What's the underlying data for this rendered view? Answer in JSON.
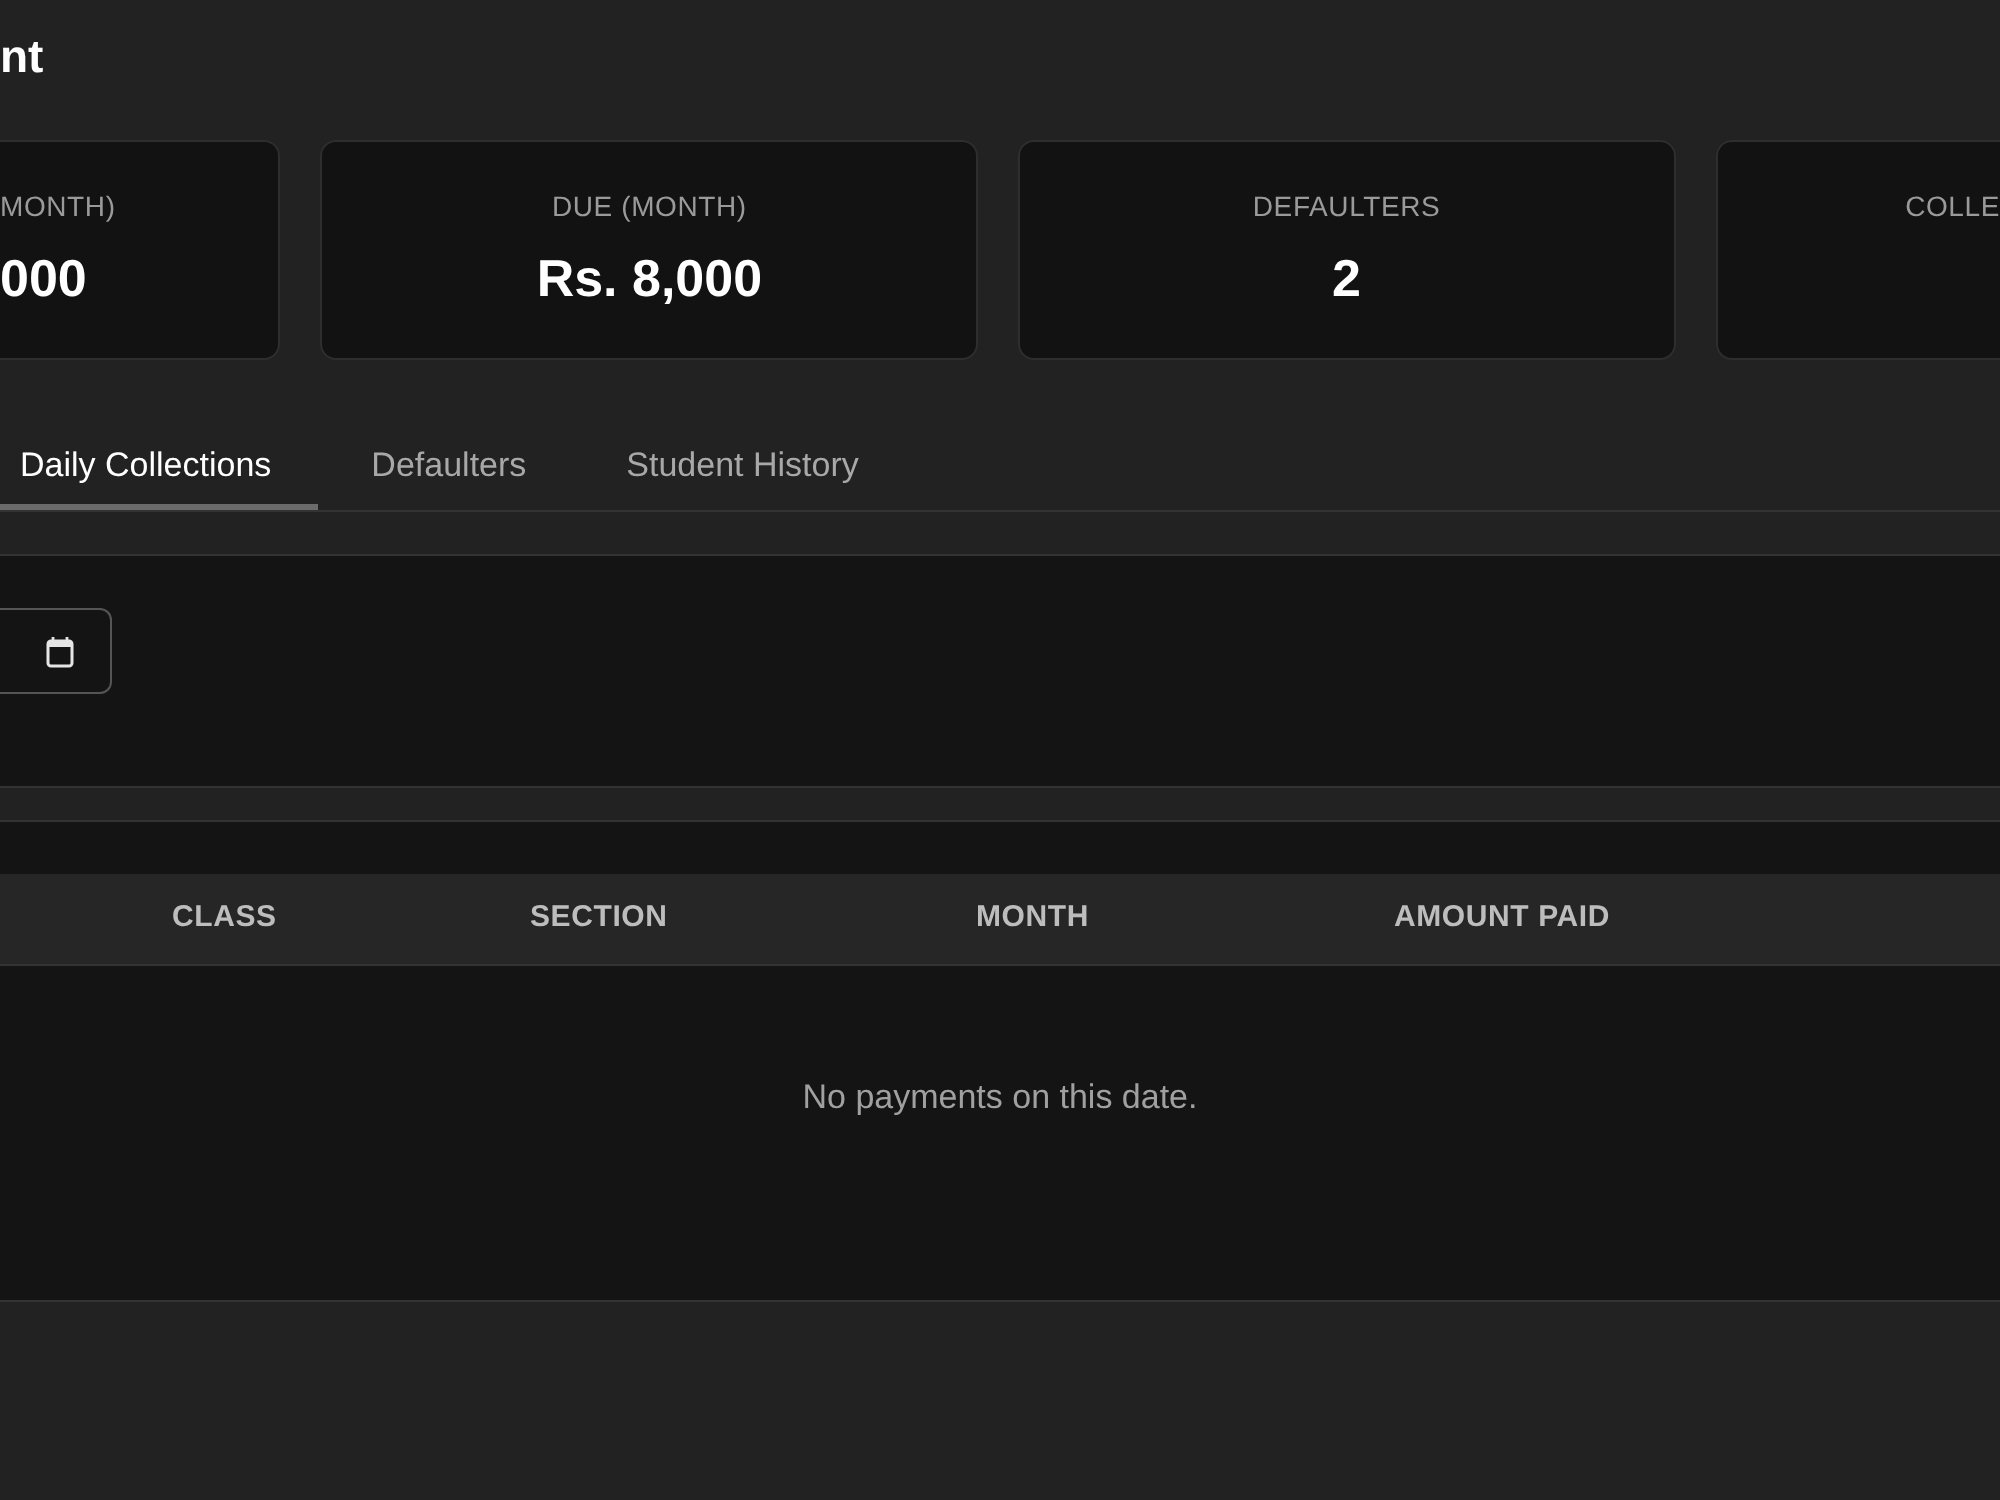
{
  "page": {
    "title": "nt"
  },
  "stats": [
    {
      "label": "MONTH)",
      "value": "000"
    },
    {
      "label": "DUE (MONTH)",
      "value": "Rs. 8,000"
    },
    {
      "label": "DEFAULTERS",
      "value": "2"
    },
    {
      "label": "COLLE"
    }
  ],
  "tabs": [
    {
      "label": "Daily Collections",
      "selected": true
    },
    {
      "label": "Defaulters",
      "selected": false
    },
    {
      "label": "Student History",
      "selected": false
    }
  ],
  "table": {
    "columns": [
      "CLASS",
      "SECTION",
      "MONTH",
      "AMOUNT PAID"
    ],
    "empty_message": "No payments on this date."
  }
}
